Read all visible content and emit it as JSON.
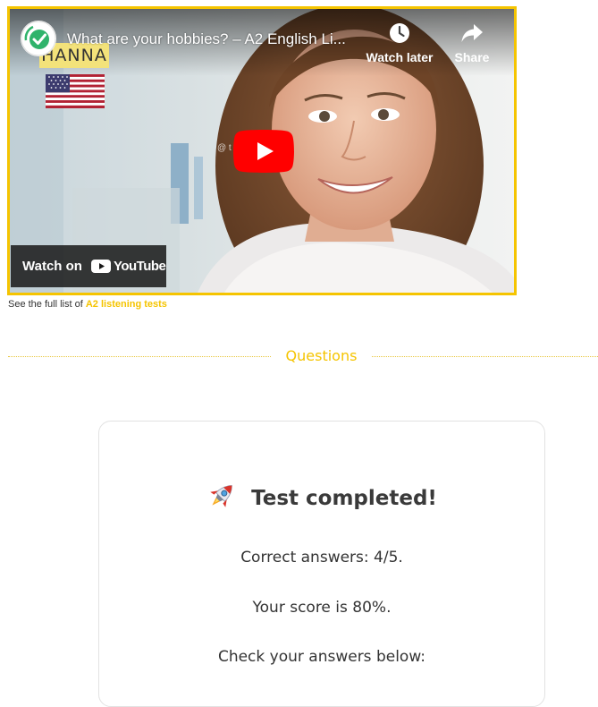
{
  "video": {
    "title": "What are your hobbies? – A2 English Li...",
    "watch_later_label": "Watch later",
    "share_label": "Share",
    "watch_on_label": "Watch on",
    "youtube_label": "YouTube",
    "name_tag": "HANNA",
    "watermark": "@ t               .com",
    "icons": {
      "watch_later": "clock-icon",
      "share": "share-arrow-icon",
      "play": "play-icon",
      "channel": "test-english-check-icon",
      "flag": "usa-flag-icon"
    },
    "colors": {
      "frame_border": "#f5c400",
      "play_red": "#ff0000"
    }
  },
  "full_list": {
    "prefix": "See the full list of",
    "link_text": "A2 listening tests"
  },
  "questions_heading": "Questions",
  "result": {
    "title": "Test completed!",
    "icon": "rocket-icon",
    "correct_answers": "Correct answers: 4/5.",
    "score": "Your score is 80%.",
    "check_answers": "Check your answers below:"
  },
  "colors": {
    "accent": "#f5c400",
    "text": "#333333"
  }
}
